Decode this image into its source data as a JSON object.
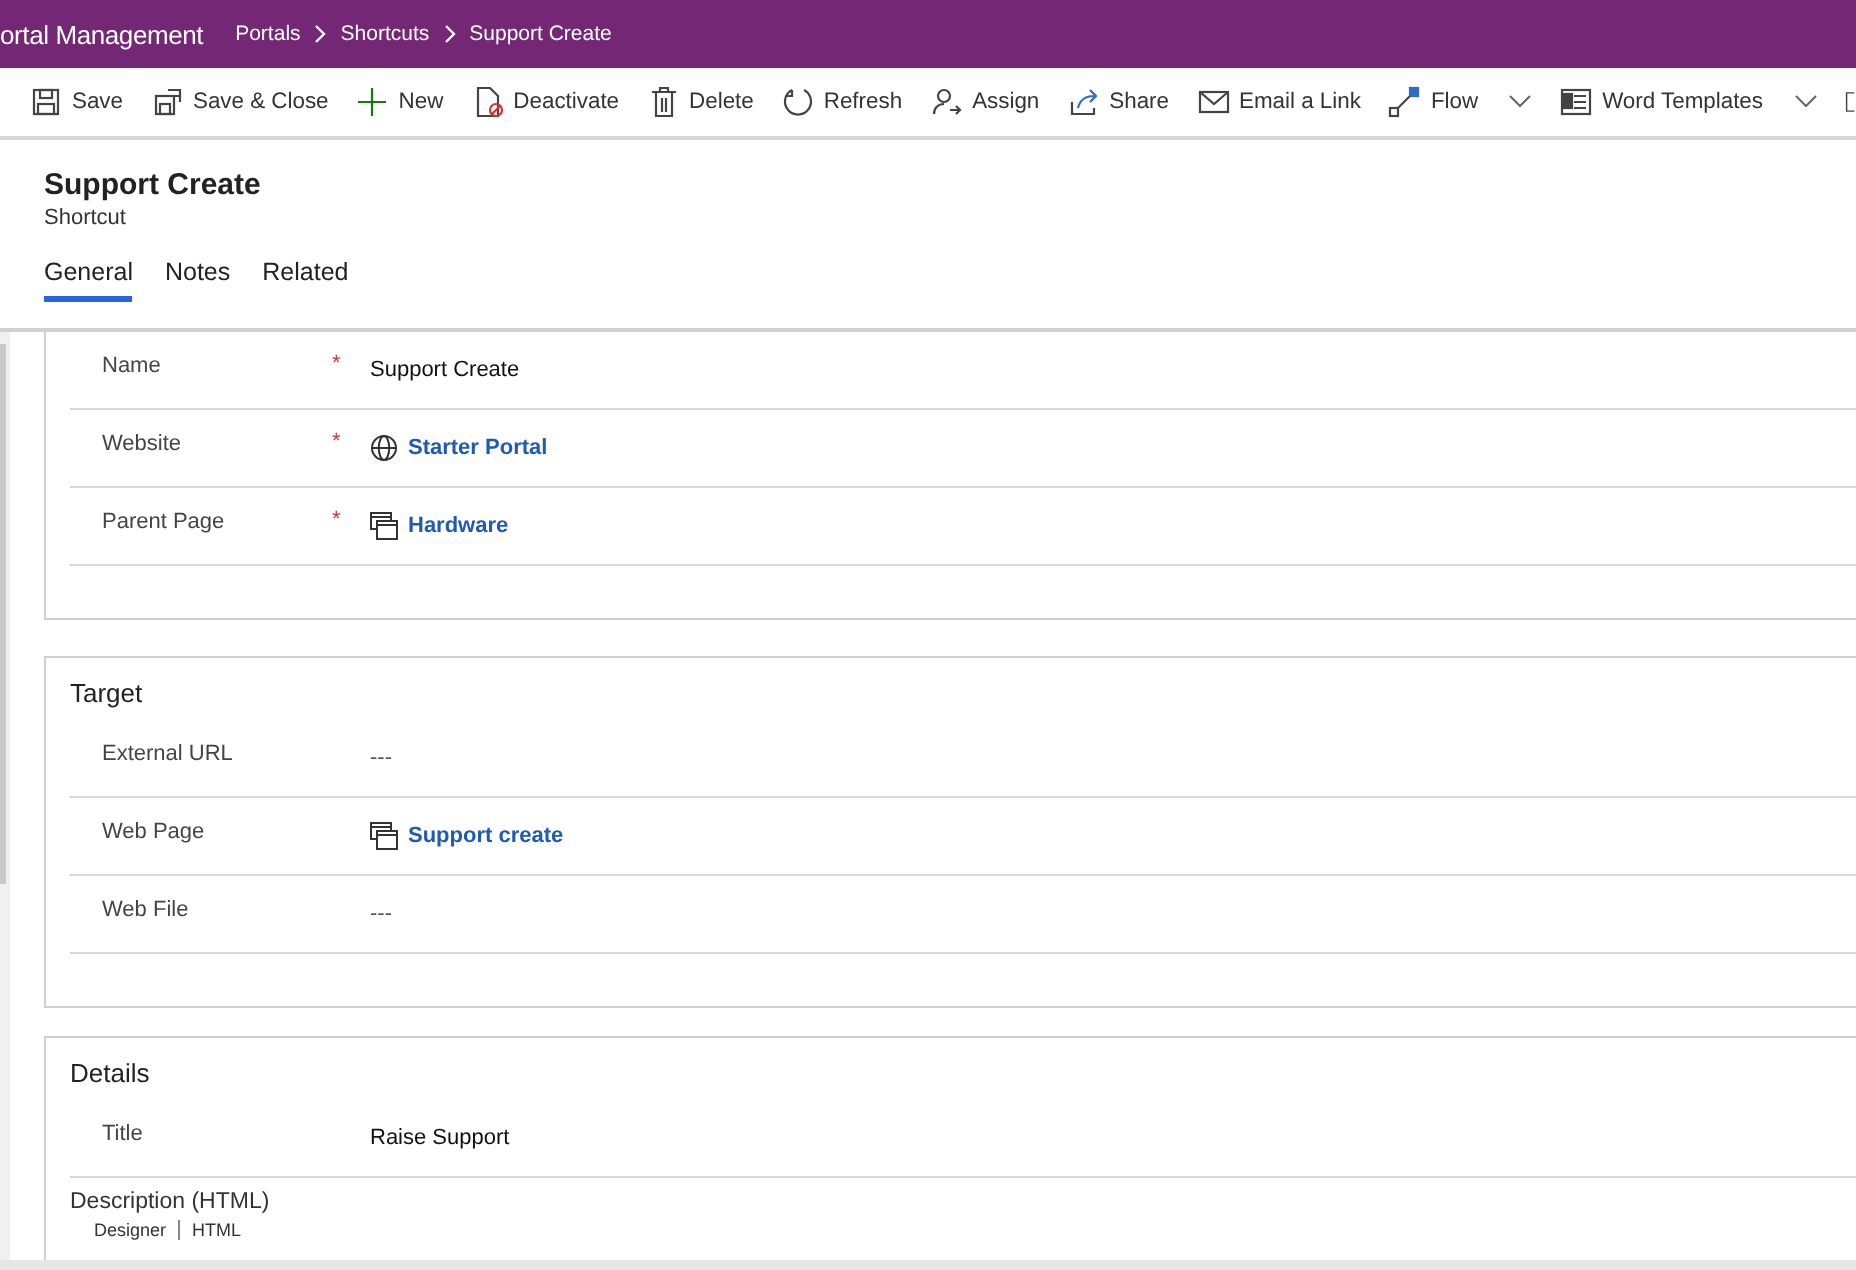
{
  "app_title": "ortal Management",
  "breadcrumbs": [
    "Portals",
    "Shortcuts",
    "Support Create"
  ],
  "toolbar": [
    {
      "kind": "save",
      "label": "Save",
      "dropdown": false
    },
    {
      "kind": "save_close",
      "label": "Save & Close",
      "dropdown": false
    },
    {
      "kind": "new",
      "label": "New",
      "dropdown": false
    },
    {
      "kind": "deactivate",
      "label": "Deactivate",
      "dropdown": false
    },
    {
      "kind": "delete",
      "label": "Delete",
      "dropdown": false
    },
    {
      "kind": "refresh",
      "label": "Refresh",
      "dropdown": false
    },
    {
      "kind": "assign",
      "label": "Assign",
      "dropdown": false
    },
    {
      "kind": "share",
      "label": "Share",
      "dropdown": false
    },
    {
      "kind": "email",
      "label": "Email a Link",
      "dropdown": false
    },
    {
      "kind": "flow",
      "label": "Flow",
      "dropdown": true
    },
    {
      "kind": "word",
      "label": "Word Templates",
      "dropdown": true
    }
  ],
  "record": {
    "title": "Support Create",
    "entity": "Shortcut"
  },
  "tabs": [
    {
      "label": "General",
      "selected": true
    },
    {
      "label": "Notes",
      "selected": false
    },
    {
      "label": "Related",
      "selected": false
    }
  ],
  "sections": [
    {
      "fields": [
        {
          "label": "Name",
          "required_mark": "*",
          "kind": "text",
          "value": "Support Create"
        },
        {
          "label": "Website",
          "required_mark": "*",
          "kind": "website_link",
          "value": "Starter Portal"
        },
        {
          "label": "Parent Page",
          "required_mark": "*",
          "kind": "page_link",
          "value": "Hardware"
        }
      ]
    },
    {
      "title": "Target",
      "fields": [
        {
          "label": "External URL",
          "kind": "empty",
          "value": "---"
        },
        {
          "label": "Web Page",
          "kind": "page_link",
          "value": "Support create"
        },
        {
          "label": "Web File",
          "kind": "empty",
          "value": "---"
        }
      ]
    },
    {
      "title": "Details",
      "fields": [
        {
          "label": "Title",
          "kind": "text",
          "value": "Raise Support"
        }
      ],
      "editor": {
        "label": "Description (HTML)",
        "tabs": [
          "Designer",
          "HTML"
        ]
      }
    }
  ]
}
